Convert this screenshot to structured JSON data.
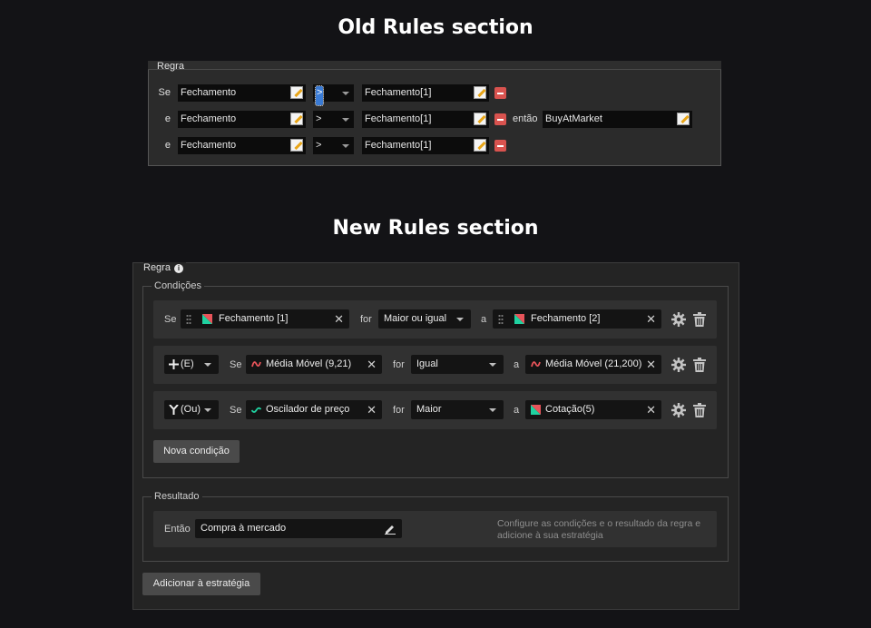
{
  "titles": {
    "old": "Old Rules section",
    "new": "New Rules section"
  },
  "old": {
    "legend": "Regra",
    "rows": [
      {
        "connector": "Se",
        "left": "Fechamento",
        "operator": ">",
        "right": "Fechamento[1]"
      },
      {
        "connector": "e",
        "left": "Fechamento",
        "operator": ">",
        "right": "Fechamento[1]"
      },
      {
        "connector": "e",
        "left": "Fechamento",
        "operator": ">",
        "right": "Fechamento[1]"
      }
    ],
    "then_label": "então",
    "then_value": "BuyAtMarket"
  },
  "new": {
    "legend": "Regra",
    "conditions_legend": "Condições",
    "rows": [
      {
        "connector": "",
        "se": "Se",
        "left": "Fechamento [1]",
        "left_icon": "candle-icon",
        "for": "for",
        "operator": "Maior ou igual",
        "a": "a",
        "right": "Fechamento [2]",
        "right_icon": "candle-icon"
      },
      {
        "connector": "(E)",
        "se": "Se",
        "left": "Média Móvel (9,21)",
        "left_icon": "moving-average-icon",
        "for": "for",
        "operator": "Igual",
        "a": "a",
        "right": "Média Móvel (21,200)",
        "right_icon": "moving-average-icon"
      },
      {
        "connector": "(Ou)",
        "se": "Se",
        "left": "Oscilador de preço",
        "left_icon": "oscillator-icon",
        "for": "for",
        "operator": "Maior",
        "a": "a",
        "right": "Cotação(5)",
        "right_icon": "candle-icon"
      }
    ],
    "new_condition_button": "Nova condição",
    "result_legend": "Resultado",
    "then_label": "Então",
    "then_value": "Compra à mercado",
    "hint": "Configure as condições e o resultado da regra e adicione à sua estratégia",
    "add_button": "Adicionar à estratégia"
  },
  "colors": {
    "accent_green": "#1fd1a0",
    "accent_red": "#e8545a",
    "minus_red": "#d9534f"
  }
}
